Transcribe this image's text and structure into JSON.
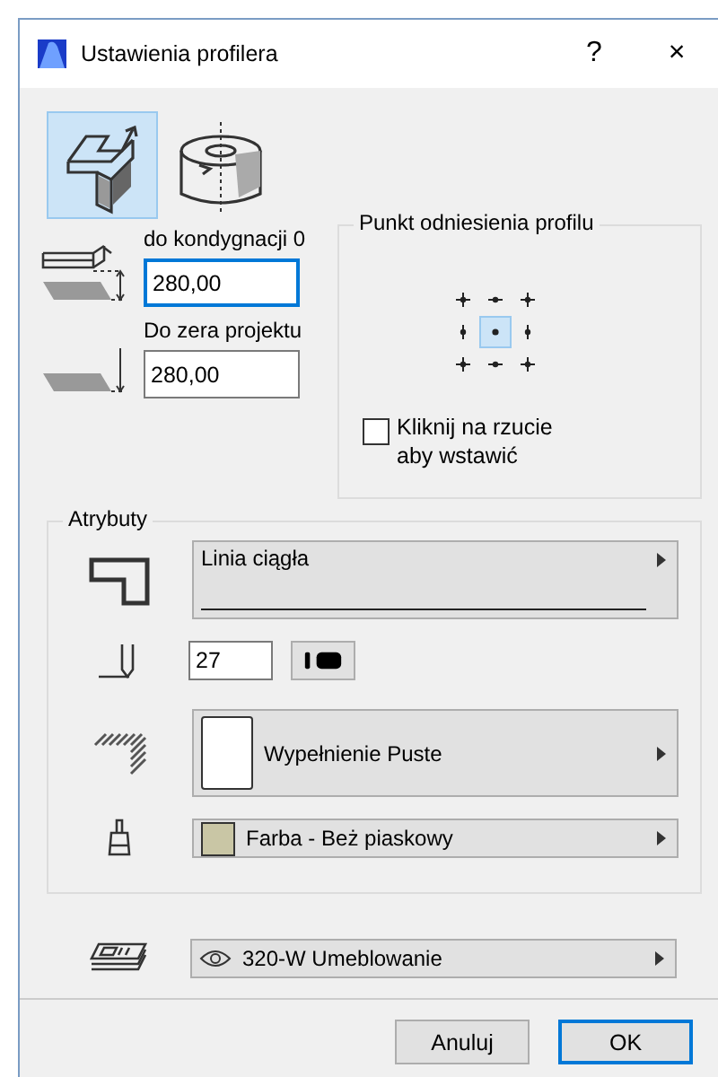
{
  "window": {
    "title": "Ustawienia profilera",
    "help": "?",
    "close": "×"
  },
  "modes": [
    {
      "kind": "straight",
      "selected": true
    },
    {
      "kind": "rotate",
      "selected": false
    }
  ],
  "elevation": [
    {
      "kind": "story",
      "label": "do kondygnacji 0",
      "value": "280,00",
      "focused": true
    },
    {
      "kind": "zero",
      "label": "Do zera projektu",
      "value": "280,00",
      "focused": false
    }
  ],
  "anchor": {
    "title": "Punkt odniesienia profilu",
    "points": [
      {
        "selected": false
      },
      {
        "selected": false
      },
      {
        "selected": false
      },
      {
        "selected": false
      },
      {
        "selected": true
      },
      {
        "selected": false
      },
      {
        "selected": false
      },
      {
        "selected": false
      },
      {
        "selected": false
      }
    ],
    "click_to_place": {
      "label": "Kliknij na rzucie aby wstawić",
      "checked": false
    }
  },
  "attributes": {
    "title": "Atrybuty",
    "items": [
      {
        "kind": "line",
        "value": "Linia ciągła"
      },
      {
        "kind": "pen",
        "value": "27"
      },
      {
        "kind": "fill",
        "value": "Wypełnienie Puste",
        "color": "#ffffff"
      },
      {
        "kind": "paint",
        "value": "Farba - Beż piaskowy",
        "color": "#c9c6a5"
      }
    ]
  },
  "layer": {
    "value": "320-W Umeblowanie",
    "visible": true
  },
  "buttons": [
    {
      "label": "Anuluj",
      "default": false
    },
    {
      "label": "OK",
      "default": true
    }
  ]
}
